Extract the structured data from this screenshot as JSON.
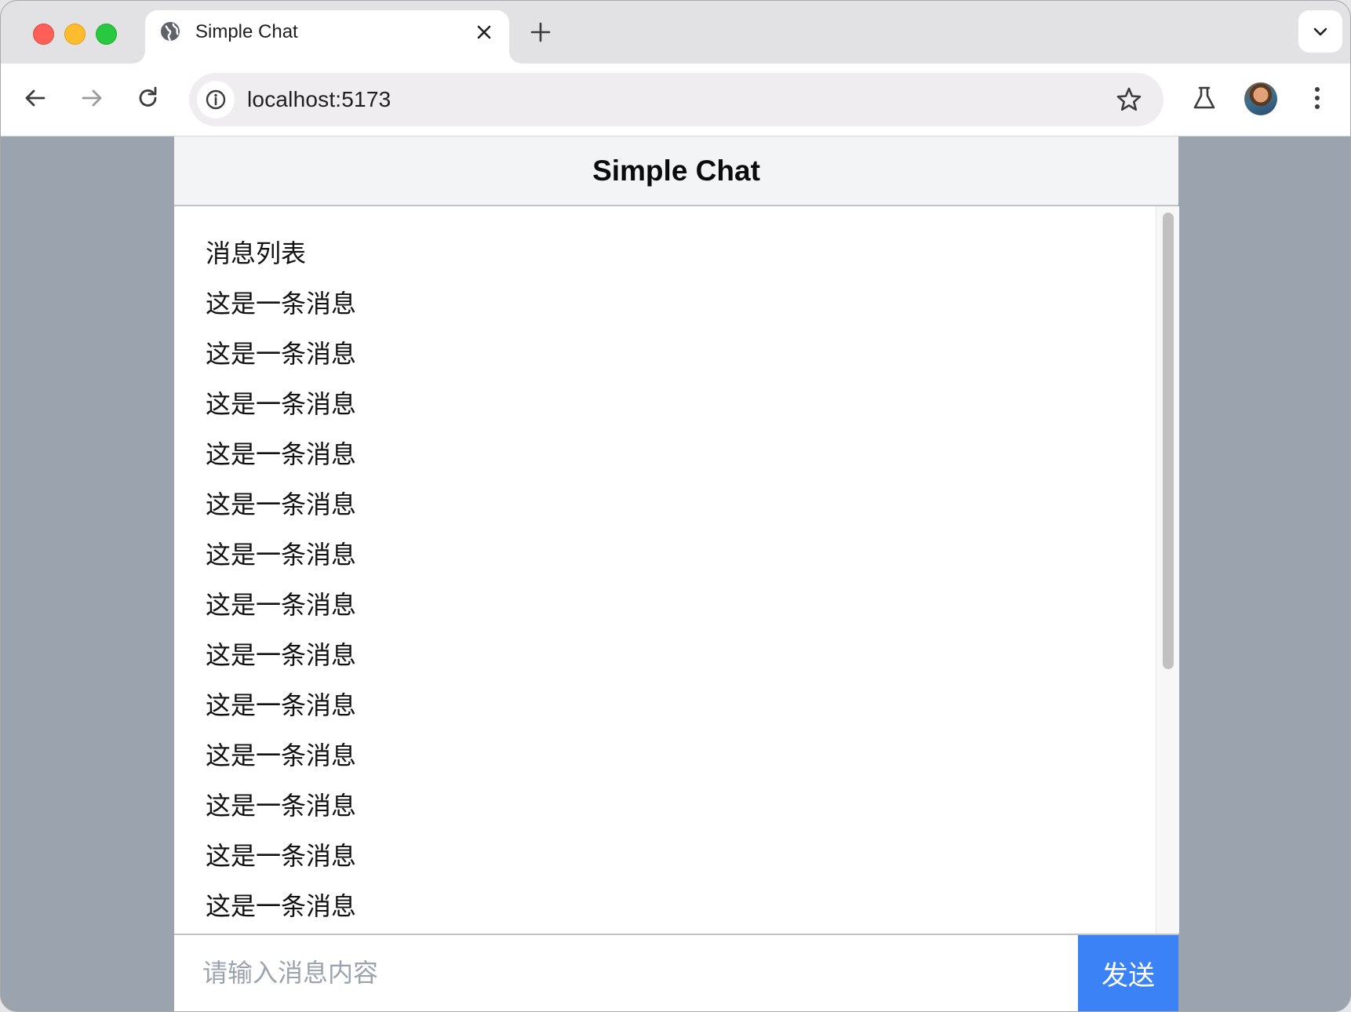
{
  "browser": {
    "tab_title": "Simple Chat",
    "url": "localhost:5173"
  },
  "app": {
    "title": "Simple Chat",
    "messages_heading": "消息列表",
    "messages": [
      "这是一条消息",
      "这是一条消息",
      "这是一条消息",
      "这是一条消息",
      "这是一条消息",
      "这是一条消息",
      "这是一条消息",
      "这是一条消息",
      "这是一条消息",
      "这是一条消息",
      "这是一条消息",
      "这是一条消息",
      "这是一条消息"
    ],
    "input_placeholder": "请输入消息内容",
    "input_value": "",
    "send_label": "发送"
  },
  "colors": {
    "page_background": "#9ba3ae",
    "header_background": "#f3f4f6",
    "send_button": "#3b82f6"
  },
  "icons": {
    "tab_favicon": "globe-icon",
    "tab_close": "close-icon",
    "new_tab": "plus-icon",
    "tab_search": "chevron-down-icon",
    "back": "back-arrow-icon",
    "forward": "forward-arrow-icon",
    "reload": "reload-icon",
    "site_info": "info-icon",
    "bookmark": "star-icon",
    "labs": "flask-icon",
    "menu": "kebab-menu-icon"
  }
}
